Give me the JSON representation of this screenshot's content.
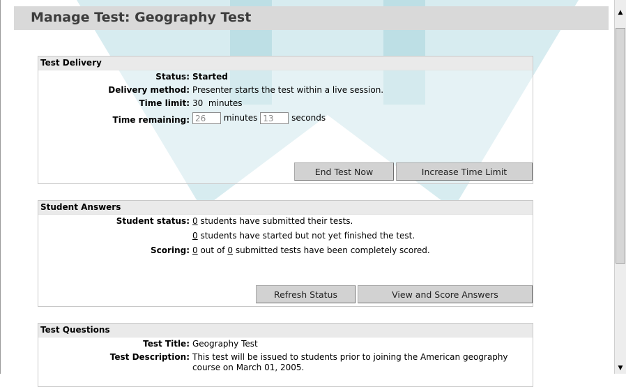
{
  "page": {
    "title": "Manage Test: Geography Test"
  },
  "delivery": {
    "header": "Test Delivery",
    "status_label": "Status:",
    "status_value": "Started",
    "method_label": "Delivery method:",
    "method_value": "Presenter starts the test within a live session.",
    "time_limit_label": "Time limit:",
    "time_limit_value": "30",
    "time_limit_unit": "minutes",
    "remaining_label": "Time remaining:",
    "remaining_minutes": "26",
    "minutes_word": "minutes",
    "remaining_seconds": "13",
    "seconds_word": "seconds",
    "end_button": "End Test Now",
    "increase_button": "Increase Time Limit"
  },
  "answers": {
    "header": "Student Answers",
    "student_status_label": "Student status:",
    "submitted_count": "0",
    "submitted_text": "students have submitted their tests.",
    "started_count": "0",
    "started_text": "students have started but not yet finished the test.",
    "scoring_label": "Scoring:",
    "scored_count": "0",
    "out_of_text": "out of",
    "submitted_total": "0",
    "scored_text": "submitted tests have been completely scored.",
    "refresh_button": "Refresh Status",
    "view_button": "View and Score Answers"
  },
  "questions": {
    "header": "Test Questions",
    "title_label": "Test Title:",
    "title_value": "Geography Test",
    "description_label": "Test Description:",
    "description_value": "This test will be issued to students prior to joining the American geography",
    "description_value_2": "course on March 01, 2005."
  },
  "colors": {
    "watermark": "#3fa7b6",
    "header_bg": "#eaeaea",
    "button_bg": "#d2d2d2"
  }
}
